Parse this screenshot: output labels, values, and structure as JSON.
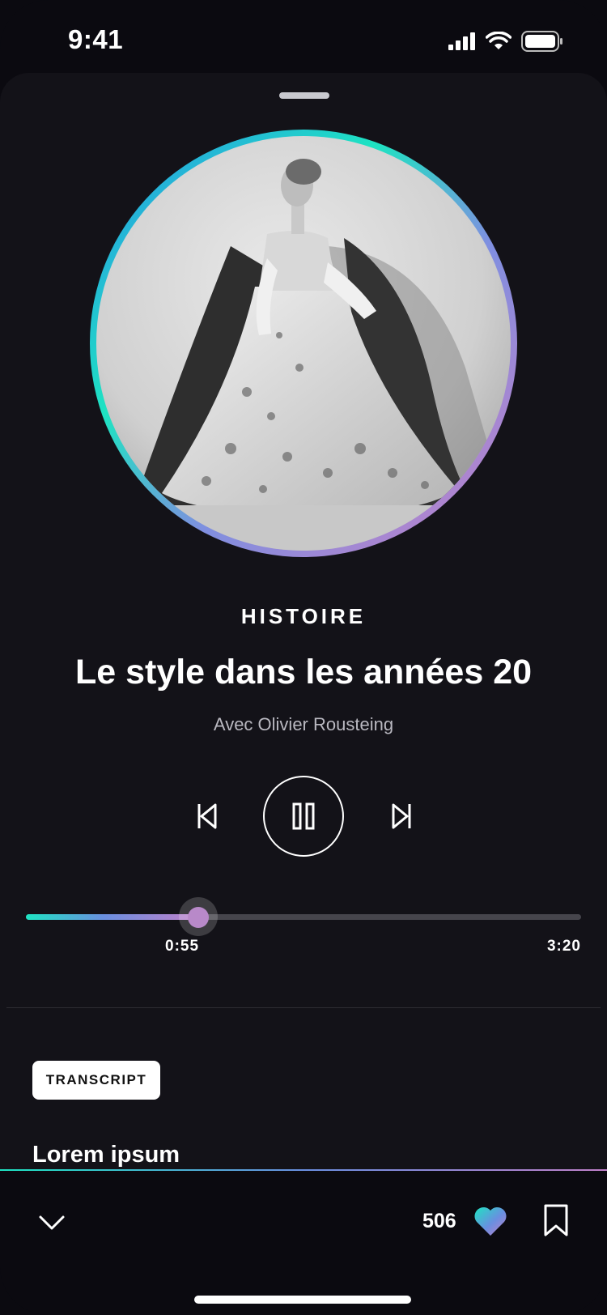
{
  "status_bar": {
    "time": "9:41"
  },
  "player": {
    "category": "HISTOIRE",
    "title": "Le style dans les années 20",
    "subtitle": "Avec Olivier Rousteing",
    "progress": 0.31,
    "current_time": "0:55",
    "total_time": "3:20"
  },
  "transcript": {
    "button_label": "TRANSCRIPT",
    "heading": "Lorem ipsum"
  },
  "bottom_bar": {
    "likes": "506"
  },
  "colors": {
    "accent_teal": "#1ee3c2",
    "accent_blue": "#6a8fe0",
    "accent_pink": "#c080c9",
    "sheet_bg": "#131218",
    "page_bg": "#0b0a10"
  },
  "icons": [
    "signal-icon",
    "wifi-icon",
    "battery-icon",
    "previous-track-icon",
    "pause-icon",
    "next-track-icon",
    "chevron-down-icon",
    "heart-icon",
    "bookmark-icon"
  ]
}
